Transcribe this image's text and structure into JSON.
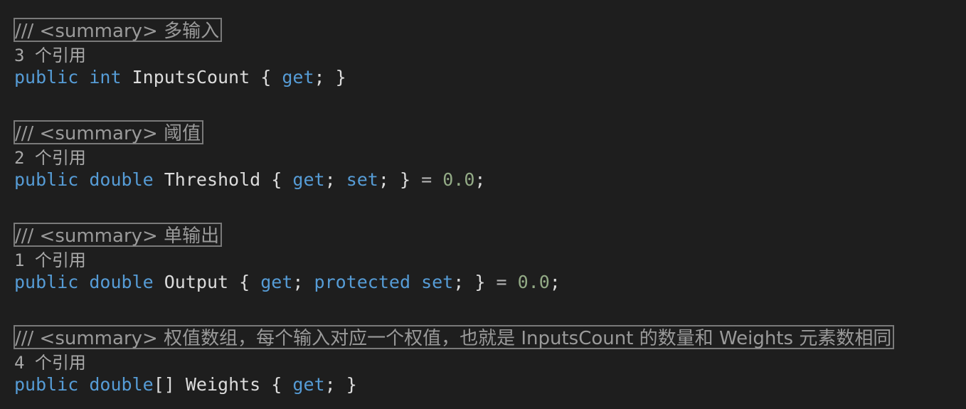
{
  "members": [
    {
      "summary": "/// <summary> 多输入",
      "refs": "3 个引用",
      "tokens": {
        "k1": "public",
        "k2": "int",
        "name": "InputsCount",
        "open": "{",
        "get": "get",
        "semi1": ";",
        "close": "}"
      }
    },
    {
      "summary": "/// <summary> 阈值",
      "refs": "2 个引用",
      "tokens": {
        "k1": "public",
        "k2": "double",
        "name": "Threshold",
        "open": "{",
        "get": "get",
        "semi1": ";",
        "set": "set",
        "semi2": ";",
        "close": "}",
        "eq": "=",
        "value": "0.0",
        "end": ";"
      }
    },
    {
      "summary": "/// <summary> 单输出",
      "refs": "1 个引用",
      "tokens": {
        "k1": "public",
        "k2": "double",
        "name": "Output",
        "open": "{",
        "get": "get",
        "semi1": ";",
        "prot": "protected",
        "set": "set",
        "semi2": ";",
        "close": "}",
        "eq": "=",
        "value": "0.0",
        "end": ";"
      }
    },
    {
      "summary": "/// <summary> 权值数组，每个输入对应一个权值，也就是 InputsCount 的数量和 Weights 元素数相同",
      "refs": "4 个引用",
      "tokens": {
        "k1": "public",
        "k2": "double",
        "brackets": "[]",
        "name": "Weights",
        "open": "{",
        "get": "get",
        "semi1": ";",
        "close": "}"
      }
    }
  ],
  "colors": {
    "background": "#1e1e1e",
    "keyword": "#569cd6",
    "number": "#93ab86",
    "text": "#dcdcdc",
    "comment": "#9a9a9a",
    "refs": "#a8a8a8",
    "summary_border": "#7a7a7a"
  }
}
